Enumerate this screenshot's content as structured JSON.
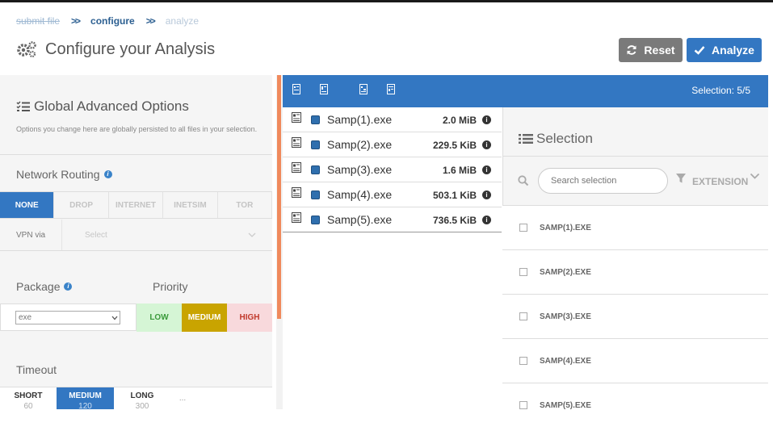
{
  "breadcrumb": {
    "step1": "submit file",
    "step2": "configure",
    "step3": "analyze"
  },
  "header": {
    "title": "Configure your Analysis",
    "reset_label": "Reset",
    "analyze_label": "Analyze"
  },
  "global": {
    "title": "Global Advanced Options",
    "description": "Options you change here are globally persisted to all files in your selection.",
    "network_label": "Network Routing",
    "routes": [
      "NONE",
      "DROP",
      "INTERNET",
      "INETSIM",
      "TOR"
    ],
    "active_route": "NONE",
    "vpn_label": "VPN via",
    "vpn_placeholder": "Select",
    "package_label": "Package",
    "package_value": "exe",
    "priority_label": "Priority",
    "priorities": {
      "low": "LOW",
      "medium": "MEDIUM",
      "high": "HIGH"
    },
    "timeout_label": "Timeout",
    "timeouts": [
      {
        "label": "SHORT",
        "value": "60"
      },
      {
        "label": "MEDIUM",
        "value": "120"
      },
      {
        "label": "LONG",
        "value": "300"
      }
    ],
    "timeout_more": "..."
  },
  "files": {
    "selection_count": "Selection: 5/5",
    "items": [
      {
        "name": "Samp(1).exe",
        "size": "2.0 MiB"
      },
      {
        "name": "Samp(2).exe",
        "size": "229.5 KiB"
      },
      {
        "name": "Samp(3).exe",
        "size": "1.6 MiB"
      },
      {
        "name": "Samp(4).exe",
        "size": "503.1 KiB"
      },
      {
        "name": "Samp(5).exe",
        "size": "736.5 KiB"
      }
    ]
  },
  "selection": {
    "title": "Selection",
    "search_placeholder": "Search selection",
    "filter_label": "EXTENSION",
    "items": [
      "SAMP(1).EXE",
      "SAMP(2).EXE",
      "SAMP(3).EXE",
      "SAMP(4).EXE",
      "SAMP(5).EXE"
    ]
  },
  "colors": {
    "accent": "#3377c2",
    "reset": "#7a7a7a",
    "scroll_thumb": "#f08a5d",
    "priority_low_bg": "#d5f5d5",
    "priority_medium_bg": "#c9a400",
    "priority_high_bg": "#f8d9dc"
  }
}
